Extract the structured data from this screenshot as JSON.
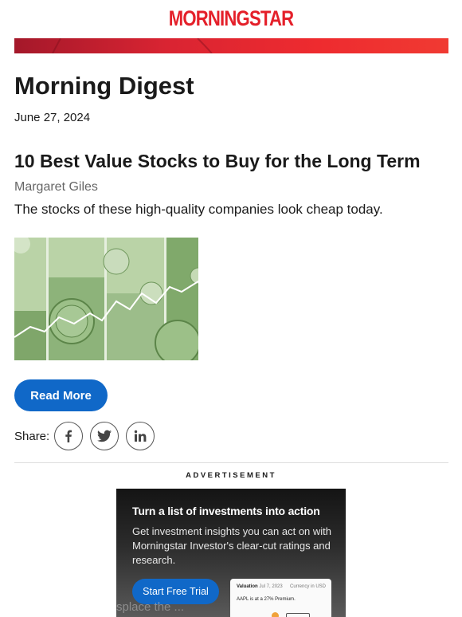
{
  "brand": {
    "logo_text": "MORNINGSTAR",
    "color": "#e4202a"
  },
  "newsletter": {
    "title": "Morning Digest",
    "date": "June 27, 2024"
  },
  "article": {
    "title": "10 Best Value Stocks to Buy for the Long Term",
    "author": "Margaret Giles",
    "summary": "The stocks of these high-quality companies look cheap today.",
    "read_more_label": "Read More"
  },
  "share": {
    "label": "Share:",
    "buttons": [
      {
        "name": "facebook",
        "icon": "facebook-icon"
      },
      {
        "name": "twitter",
        "icon": "twitter-icon"
      },
      {
        "name": "linkedin",
        "icon": "linkedin-icon"
      }
    ]
  },
  "advertisement": {
    "label": "ADVERTISEMENT",
    "headline": "Turn a list of investments into action",
    "body": "Get investment insights you can act on with Morningstar Investor's clear-cut ratings and research.",
    "cta_label": "Start Free Trial",
    "card": {
      "title": "Valuation",
      "date": "Jul 7, 2023",
      "currency": "Currency in USD",
      "line": "AAPL is at a 27% Premium."
    }
  },
  "preheader_ghost": "splace the ...",
  "colors": {
    "primary_button": "#1068c8",
    "banner_red": "#e4202a"
  }
}
